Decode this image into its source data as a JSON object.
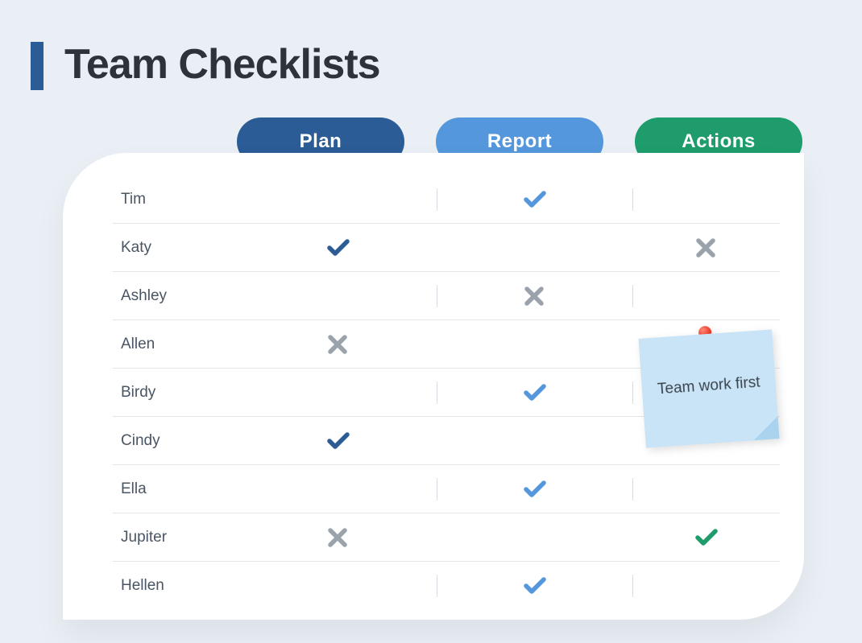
{
  "title": "Team Checklists",
  "columns": {
    "plan": "Plan",
    "report": "Report",
    "actions": "Actions"
  },
  "colors": {
    "plan": "#2c5c96",
    "report": "#5597dc",
    "actions": "#1e9c6b",
    "check_dark": "#2c5c96",
    "check_light": "#5597dc",
    "check_green": "#1e9c6b",
    "cross_gray": "#9aa3ac"
  },
  "note": {
    "text": "Team work first"
  },
  "rows": [
    {
      "name": "Tim",
      "plan": "",
      "report": "check-light",
      "actions": ""
    },
    {
      "name": "Katy",
      "plan": "check-dark",
      "report": "",
      "actions": "cross-gray"
    },
    {
      "name": "Ashley",
      "plan": "",
      "report": "cross-gray",
      "actions": ""
    },
    {
      "name": "Allen",
      "plan": "cross-gray",
      "report": "",
      "actions": ""
    },
    {
      "name": "Birdy",
      "plan": "",
      "report": "check-light",
      "actions": ""
    },
    {
      "name": "Cindy",
      "plan": "check-dark",
      "report": "",
      "actions": ""
    },
    {
      "name": "Ella",
      "plan": "",
      "report": "check-light",
      "actions": ""
    },
    {
      "name": "Jupiter",
      "plan": "cross-gray",
      "report": "",
      "actions": "check-green"
    },
    {
      "name": "Hellen",
      "plan": "",
      "report": "check-light",
      "actions": ""
    }
  ]
}
